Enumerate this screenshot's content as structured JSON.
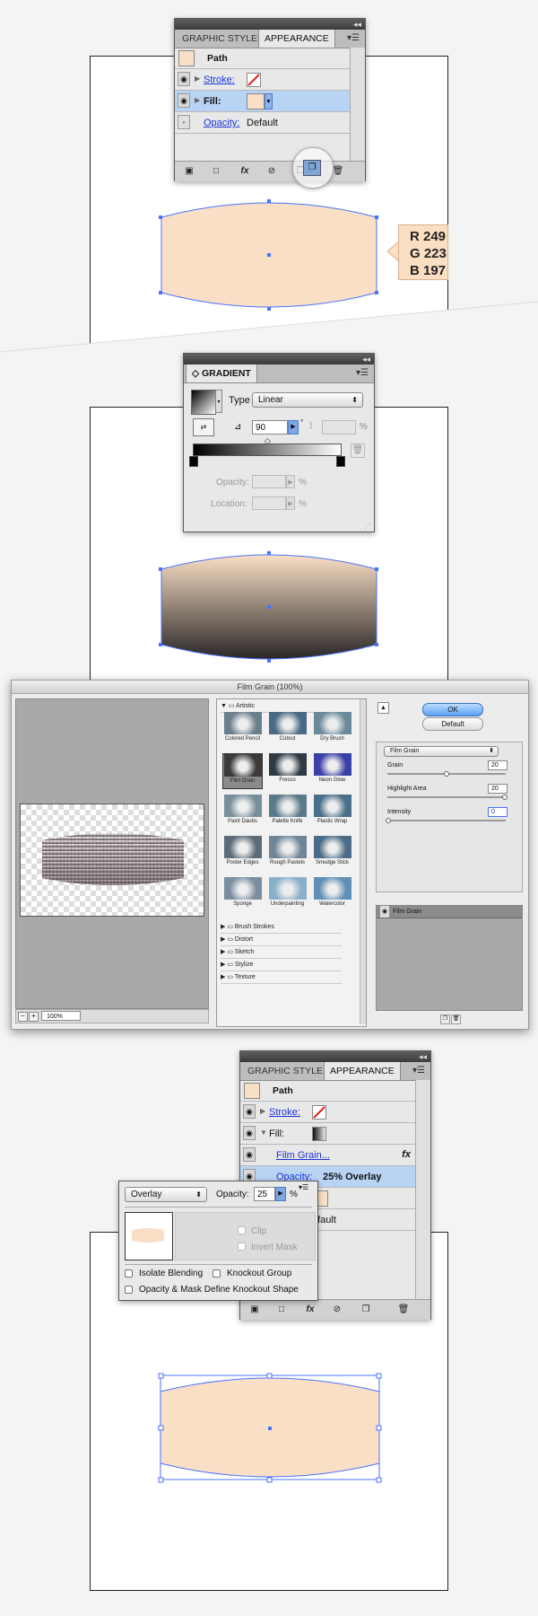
{
  "colors": {
    "skin": "#f9dfc5",
    "accent_blue": "#4a72ff",
    "selection": "#b9d3f4",
    "link": "#1a33d8"
  },
  "appearance_panel_1": {
    "tabs": [
      "GRAPHIC STYLES",
      "APPEARANCE"
    ],
    "title": "Path",
    "rows": [
      {
        "label": "Stroke:"
      },
      {
        "label": "Fill:"
      },
      {
        "label": "Opacity:",
        "value": "Default"
      }
    ],
    "footer_icons": [
      "new-art-icon",
      "clear-icon",
      "fx-icon",
      "no-icon",
      "duplicate-icon",
      "trash-icon"
    ]
  },
  "rgb_callout": {
    "r": "R 249",
    "g": "G 223",
    "b": "B 197"
  },
  "gradient_panel": {
    "title": "GRADIENT",
    "type_label": "Type",
    "type_value": "Linear",
    "angle_value": "90",
    "percent": "%",
    "opacity_label": "Opacity:",
    "location_label": "Location:"
  },
  "film_grain_dialog": {
    "title": "Film Grain (100%)",
    "zoom": "100%",
    "folder_open": "Artistic",
    "thumbs": [
      "Colored Pencil",
      "Cutout",
      "Dry Brush",
      "Film Grain",
      "Fresco",
      "Neon Glow",
      "Paint Daubs",
      "Palette Knife",
      "Plastic Wrap",
      "Poster Edges",
      "Rough Pastels",
      "Smudge Stick",
      "Sponge",
      "Underpainting",
      "Watercolor"
    ],
    "folders": [
      "Brush Strokes",
      "Distort",
      "Sketch",
      "Stylize",
      "Texture"
    ],
    "ok": "OK",
    "default": "Default",
    "filter_select": "Film Grain",
    "params": [
      {
        "label": "Grain",
        "value": "20",
        "level": 0.5
      },
      {
        "label": "Highlight Area",
        "value": "20",
        "level": 1.0
      },
      {
        "label": "Intensity",
        "value": "0",
        "level": 0.0
      }
    ],
    "layer_name": "Film Grain"
  },
  "appearance_panel_2": {
    "tabs": [
      "GRAPHIC STYLES",
      "APPEARANCE"
    ],
    "title": "Path",
    "stroke_label": "Stroke:",
    "fill_label": "Fill:",
    "effect_label": "Film Grain...",
    "opacity_label": "Opacity:",
    "opacity_value": "25% Overlay",
    "default_value": "efault"
  },
  "transparency_popup": {
    "blend_mode": "Overlay",
    "opacity_label": "Opacity:",
    "opacity_value": "25",
    "percent": "%",
    "clip": "Clip",
    "invert_mask": "Invert Mask",
    "isolate": "Isolate Blending",
    "knockout": "Knockout Group",
    "opacity_mask": "Opacity & Mask Define Knockout Shape"
  }
}
